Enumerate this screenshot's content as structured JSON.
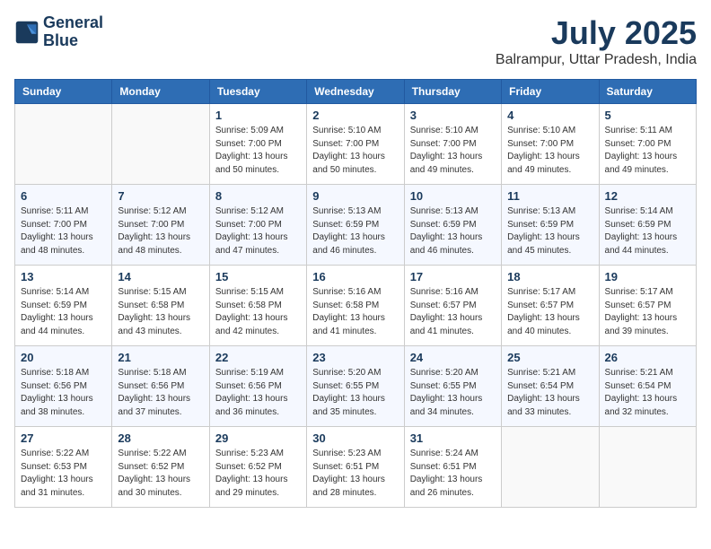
{
  "logo": {
    "line1": "General",
    "line2": "Blue"
  },
  "title": {
    "month_year": "July 2025",
    "location": "Balrampur, Uttar Pradesh, India"
  },
  "weekdays": [
    "Sunday",
    "Monday",
    "Tuesday",
    "Wednesday",
    "Thursday",
    "Friday",
    "Saturday"
  ],
  "weeks": [
    [
      {
        "day": "",
        "info": ""
      },
      {
        "day": "",
        "info": ""
      },
      {
        "day": "1",
        "info": "Sunrise: 5:09 AM\nSunset: 7:00 PM\nDaylight: 13 hours\nand 50 minutes."
      },
      {
        "day": "2",
        "info": "Sunrise: 5:10 AM\nSunset: 7:00 PM\nDaylight: 13 hours\nand 50 minutes."
      },
      {
        "day": "3",
        "info": "Sunrise: 5:10 AM\nSunset: 7:00 PM\nDaylight: 13 hours\nand 49 minutes."
      },
      {
        "day": "4",
        "info": "Sunrise: 5:10 AM\nSunset: 7:00 PM\nDaylight: 13 hours\nand 49 minutes."
      },
      {
        "day": "5",
        "info": "Sunrise: 5:11 AM\nSunset: 7:00 PM\nDaylight: 13 hours\nand 49 minutes."
      }
    ],
    [
      {
        "day": "6",
        "info": "Sunrise: 5:11 AM\nSunset: 7:00 PM\nDaylight: 13 hours\nand 48 minutes."
      },
      {
        "day": "7",
        "info": "Sunrise: 5:12 AM\nSunset: 7:00 PM\nDaylight: 13 hours\nand 48 minutes."
      },
      {
        "day": "8",
        "info": "Sunrise: 5:12 AM\nSunset: 7:00 PM\nDaylight: 13 hours\nand 47 minutes."
      },
      {
        "day": "9",
        "info": "Sunrise: 5:13 AM\nSunset: 6:59 PM\nDaylight: 13 hours\nand 46 minutes."
      },
      {
        "day": "10",
        "info": "Sunrise: 5:13 AM\nSunset: 6:59 PM\nDaylight: 13 hours\nand 46 minutes."
      },
      {
        "day": "11",
        "info": "Sunrise: 5:13 AM\nSunset: 6:59 PM\nDaylight: 13 hours\nand 45 minutes."
      },
      {
        "day": "12",
        "info": "Sunrise: 5:14 AM\nSunset: 6:59 PM\nDaylight: 13 hours\nand 44 minutes."
      }
    ],
    [
      {
        "day": "13",
        "info": "Sunrise: 5:14 AM\nSunset: 6:59 PM\nDaylight: 13 hours\nand 44 minutes."
      },
      {
        "day": "14",
        "info": "Sunrise: 5:15 AM\nSunset: 6:58 PM\nDaylight: 13 hours\nand 43 minutes."
      },
      {
        "day": "15",
        "info": "Sunrise: 5:15 AM\nSunset: 6:58 PM\nDaylight: 13 hours\nand 42 minutes."
      },
      {
        "day": "16",
        "info": "Sunrise: 5:16 AM\nSunset: 6:58 PM\nDaylight: 13 hours\nand 41 minutes."
      },
      {
        "day": "17",
        "info": "Sunrise: 5:16 AM\nSunset: 6:57 PM\nDaylight: 13 hours\nand 41 minutes."
      },
      {
        "day": "18",
        "info": "Sunrise: 5:17 AM\nSunset: 6:57 PM\nDaylight: 13 hours\nand 40 minutes."
      },
      {
        "day": "19",
        "info": "Sunrise: 5:17 AM\nSunset: 6:57 PM\nDaylight: 13 hours\nand 39 minutes."
      }
    ],
    [
      {
        "day": "20",
        "info": "Sunrise: 5:18 AM\nSunset: 6:56 PM\nDaylight: 13 hours\nand 38 minutes."
      },
      {
        "day": "21",
        "info": "Sunrise: 5:18 AM\nSunset: 6:56 PM\nDaylight: 13 hours\nand 37 minutes."
      },
      {
        "day": "22",
        "info": "Sunrise: 5:19 AM\nSunset: 6:56 PM\nDaylight: 13 hours\nand 36 minutes."
      },
      {
        "day": "23",
        "info": "Sunrise: 5:20 AM\nSunset: 6:55 PM\nDaylight: 13 hours\nand 35 minutes."
      },
      {
        "day": "24",
        "info": "Sunrise: 5:20 AM\nSunset: 6:55 PM\nDaylight: 13 hours\nand 34 minutes."
      },
      {
        "day": "25",
        "info": "Sunrise: 5:21 AM\nSunset: 6:54 PM\nDaylight: 13 hours\nand 33 minutes."
      },
      {
        "day": "26",
        "info": "Sunrise: 5:21 AM\nSunset: 6:54 PM\nDaylight: 13 hours\nand 32 minutes."
      }
    ],
    [
      {
        "day": "27",
        "info": "Sunrise: 5:22 AM\nSunset: 6:53 PM\nDaylight: 13 hours\nand 31 minutes."
      },
      {
        "day": "28",
        "info": "Sunrise: 5:22 AM\nSunset: 6:52 PM\nDaylight: 13 hours\nand 30 minutes."
      },
      {
        "day": "29",
        "info": "Sunrise: 5:23 AM\nSunset: 6:52 PM\nDaylight: 13 hours\nand 29 minutes."
      },
      {
        "day": "30",
        "info": "Sunrise: 5:23 AM\nSunset: 6:51 PM\nDaylight: 13 hours\nand 28 minutes."
      },
      {
        "day": "31",
        "info": "Sunrise: 5:24 AM\nSunset: 6:51 PM\nDaylight: 13 hours\nand 26 minutes."
      },
      {
        "day": "",
        "info": ""
      },
      {
        "day": "",
        "info": ""
      }
    ]
  ]
}
